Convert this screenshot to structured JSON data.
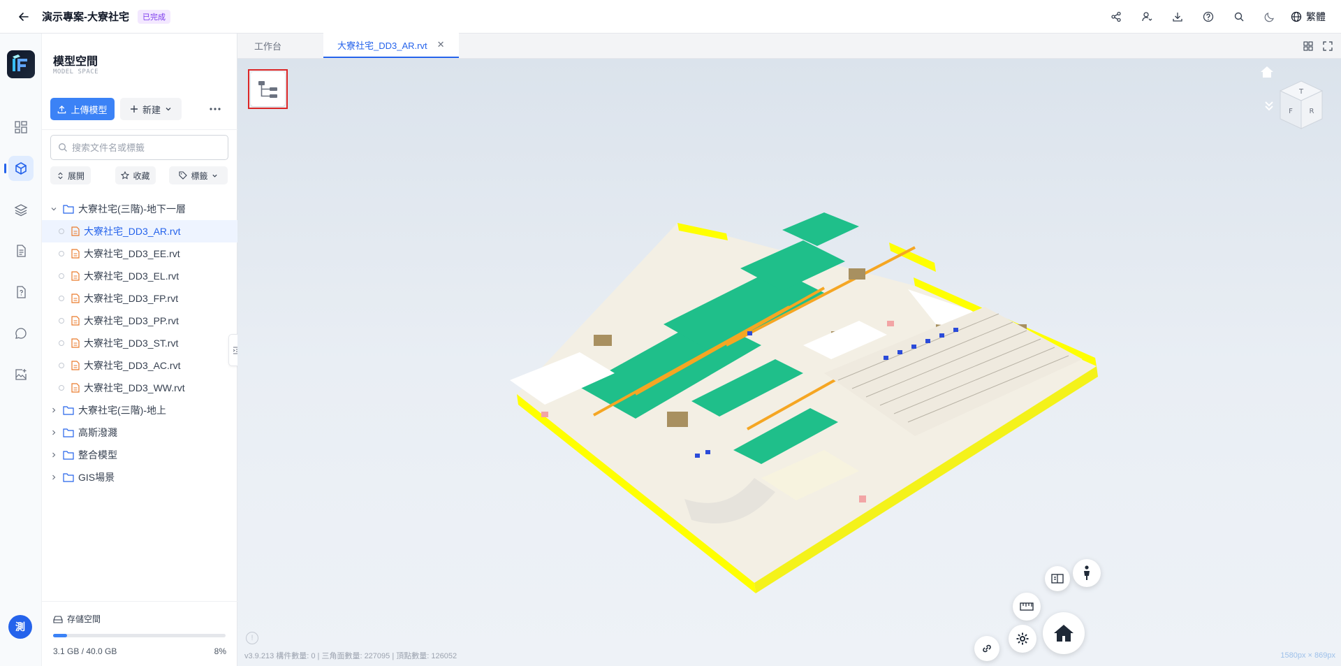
{
  "header": {
    "project_title": "演示專案-大寮社宅",
    "status": "已完成",
    "language": "繁體"
  },
  "rail": {
    "avatar_initial": "測"
  },
  "panel": {
    "title": "模型空間",
    "subtitle": "MODEL SPACE",
    "upload_label": "上傳模型",
    "new_label": "新建",
    "search_placeholder": "搜索文件名或標籤",
    "filters": {
      "expand": "展開",
      "favorite": "收藏",
      "tags": "標籤"
    },
    "tree": {
      "folder1": "大寮社宅(三階)-地下一層",
      "files": [
        "大寮社宅_DD3_AR.rvt",
        "大寮社宅_DD3_EE.rvt",
        "大寮社宅_DD3_EL.rvt",
        "大寮社宅_DD3_FP.rvt",
        "大寮社宅_DD3_PP.rvt",
        "大寮社宅_DD3_ST.rvt",
        "大寮社宅_DD3_AC.rvt",
        "大寮社宅_DD3_WW.rvt"
      ],
      "folder2": "大寮社宅(三階)-地上",
      "folder3": "高斯潑濺",
      "folder4": "整合模型",
      "folder5": "GIS場景"
    },
    "storage": {
      "label": "存儲空間",
      "usage": "3.1 GB / 40.0 GB",
      "percent": "8%",
      "fraction": 0.08
    }
  },
  "tabs": {
    "workbench": "工作台",
    "active_file": "大寮社宅_DD3_AR.rvt"
  },
  "viewport": {
    "footer": "v3.9.213    構件數量: 0 | 三角面數量: 227095 | 頂點數量: 126052",
    "resolution": "1580px × 869px",
    "cube_faces": {
      "top": "T",
      "front": "F",
      "right": "R"
    }
  },
  "colors": {
    "accent": "#2563eb",
    "upload_bg": "#3b82f6",
    "badge_bg": "#f3e8ff",
    "badge_fg": "#7c3aed",
    "highlight_border": "#dc2626",
    "model_yellow": "#ffff00",
    "model_green": "#1fbf8a",
    "model_brown": "#a89060"
  }
}
